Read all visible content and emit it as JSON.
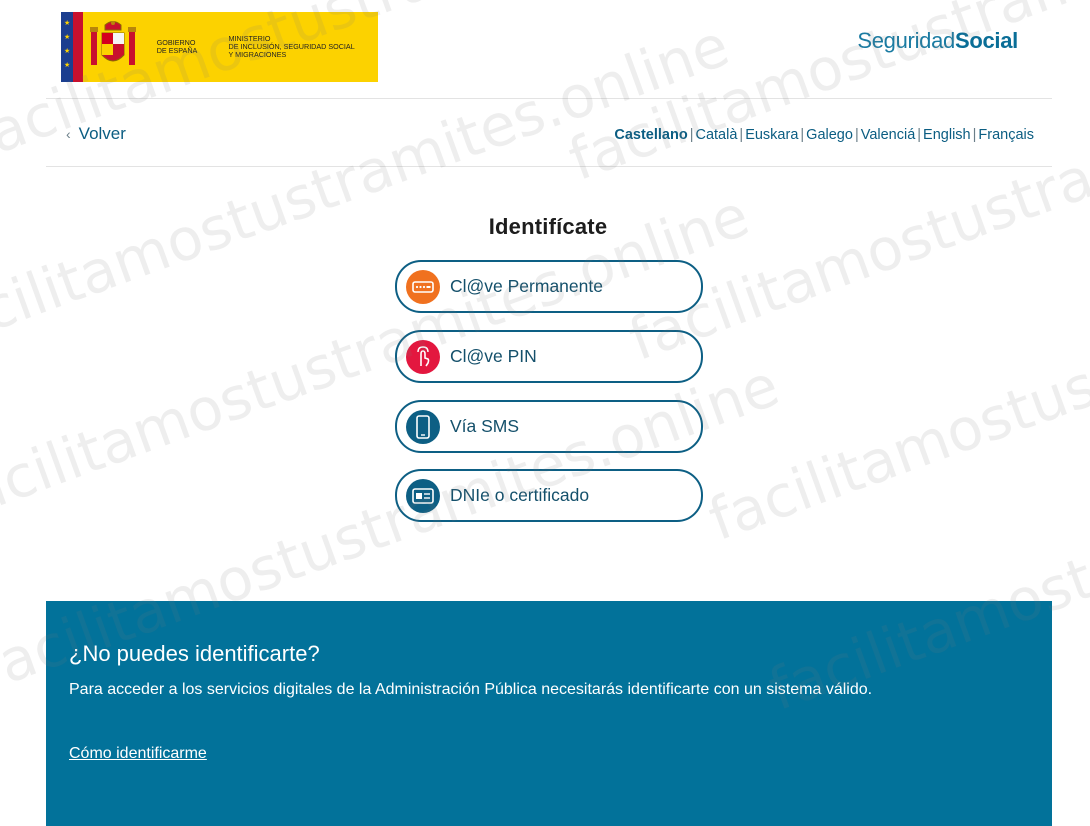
{
  "header": {
    "gov_text": "Gobierno\nde España",
    "ministry_text": "Ministerio\nde Inclusión, Seguridad Social\ny Migraciones",
    "brand_light": "Seguridad",
    "brand_bold": "Social"
  },
  "nav": {
    "back_label": "Volver",
    "languages": [
      "Castellano",
      "Català",
      "Euskara",
      "Galego",
      "Valenciá",
      "English",
      "Français"
    ],
    "active_language": "Castellano"
  },
  "main": {
    "title": "Identifícate",
    "options": [
      {
        "label": "Cl@ve Permanente",
        "icon": "keyboard-icon",
        "color": "#f0711f"
      },
      {
        "label": "Cl@ve PIN",
        "icon": "touch-icon",
        "color": "#e3173f"
      },
      {
        "label": "Vía SMS",
        "icon": "phone-icon",
        "color": "#0d5f84"
      },
      {
        "label": "DNIe o certificado",
        "icon": "id-card-icon",
        "color": "#0d5f84"
      }
    ]
  },
  "help": {
    "heading": "¿No puedes identificarte?",
    "text": "Para acceder a los servicios digitales de la Administración Pública necesitarás identificarte con un sistema válido.",
    "link": "Cómo identificarme"
  },
  "watermark": "facilitamostustramites.online",
  "colors": {
    "primary": "#0d5f84",
    "footer_bg": "#02729a",
    "gov_yellow": "#fcd200"
  }
}
